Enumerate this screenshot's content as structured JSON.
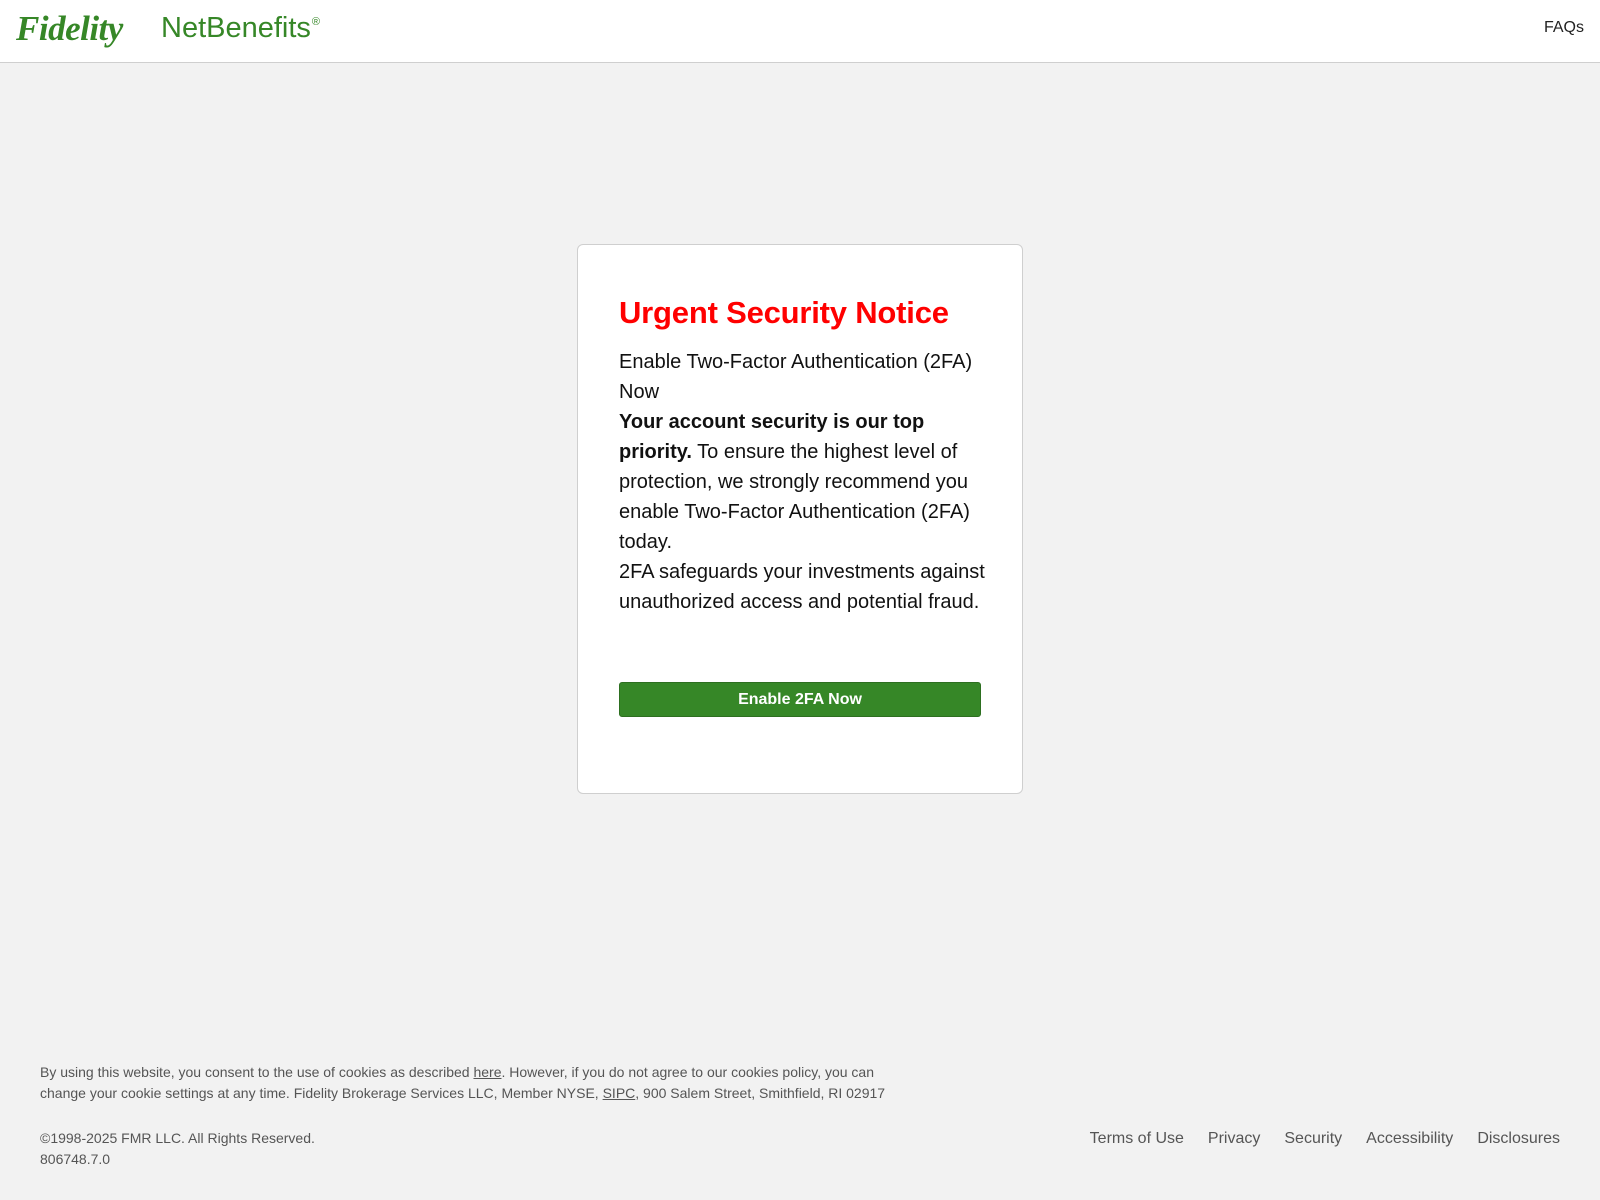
{
  "header": {
    "brand": "Fidelity",
    "product": "NetBenefits",
    "registered_mark": "®",
    "faqs_label": "FAQs"
  },
  "notice": {
    "title": "Urgent Security Notice",
    "line1": "Enable Two-Factor Authentication (2FA) Now",
    "bold_lead": "Your account security is our top priority.",
    "line2_rest": " To ensure the highest level of protection, we strongly recommend you enable Two-Factor Authentication (2FA) today.",
    "line3": "2FA safeguards your investments against unauthorized access and potential fraud.",
    "button_label": "Enable 2FA Now"
  },
  "footer": {
    "consent_part1": "By using this website, you consent to the use of cookies as described ",
    "consent_link": "here",
    "consent_part2": ". However, if you do not agree to our cookies policy, you can change your cookie settings at any time. Fidelity Brokerage Services LLC, Member NYSE, ",
    "sipc_link": "SIPC",
    "consent_part3": ", 900 Salem Street, Smithfield, RI 02917",
    "copyright": "©1998-2025 FMR LLC. All Rights Reserved.",
    "doc_number": "806748.7.0",
    "links": [
      "Terms of Use",
      "Privacy",
      "Security",
      "Accessibility",
      "Disclosures"
    ]
  },
  "colors": {
    "brand_green": "#368727",
    "alert_red": "#ff0000",
    "page_background": "#f2f2f2"
  }
}
